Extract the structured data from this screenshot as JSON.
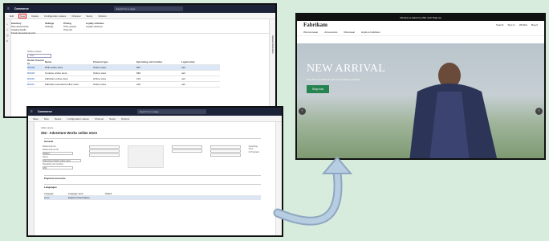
{
  "shot1": {
    "app_name": "Commerce",
    "search_placeholder": "Search for a page",
    "toolbar": [
      "Edit",
      "New",
      "Delete",
      "Configuration values",
      "Channel",
      "Setup",
      "Options"
    ],
    "highlighted_tool": "New",
    "ribbon": [
      {
        "header": "Inventory",
        "items": [
          "New assortments",
          "Catalog details",
          "Fiscal transactional print"
        ]
      },
      {
        "header": "Settings",
        "items": [
          "Settings"
        ]
      },
      {
        "header": "Pricing",
        "items": [
          "Price groups",
          "Price list"
        ]
      },
      {
        "header": "Loyalty schemes",
        "items": [
          "Loyalty schemes"
        ]
      }
    ],
    "list_title": "Online stores",
    "filter_placeholder": "Filter",
    "columns": [
      "Retail Channel Id",
      "Name",
      "Channel type",
      "Operating unit number",
      "Legal entity"
    ],
    "rows": [
      [
        "RS002",
        "RTE online store",
        "Online store",
        "097",
        "usrt"
      ],
      [
        "RS003",
        "Contoso online store",
        "Online store",
        "099",
        "usrt"
      ],
      [
        "RS016",
        "Fabrikam online store",
        "Online store",
        "123",
        "usrt"
      ],
      [
        "RS017",
        "Fabrikam extended online store",
        "Online store",
        "126",
        "usrt"
      ]
    ],
    "side_panel_label": "Related information"
  },
  "shot2": {
    "app_name": "Commerce",
    "search_placeholder": "Search for a page",
    "toolbar": [
      "Save",
      "New",
      "Delete",
      "Configuration values",
      "Channel",
      "Setup",
      "Options"
    ],
    "breadcrumb": "Online stores",
    "form_title": "252 : Adventure Works online store",
    "general_tab": "General",
    "fields": [
      {
        "label": "Retail channel",
        "value": ""
      },
      {
        "label": "Retail channel ID",
        "value": "RS021"
      },
      {
        "label": "Name",
        "value": "Adventure Works online store"
      },
      {
        "label": "Operating unit number",
        "value": "252"
      }
    ],
    "payment_tab": "Payment accounts",
    "languages_tab": "Languages",
    "lang_columns": [
      "Language",
      "Language name",
      "Default"
    ],
    "lang_rows": [
      [
        "en-us",
        "English (United States)",
        ""
      ]
    ],
    "status_label": "Operating store",
    "status_value": "In Progress"
  },
  "shot3": {
    "promo_bar": "Receive a welcome offer now! Sign up",
    "brand": "Fabrikam",
    "utility": [
      "Search",
      "Sign In",
      "Wishlist",
      "Bag 0"
    ],
    "nav": [
      "Womenswear",
      "Accessories",
      "Menswear",
      "Explore Fabrikam"
    ],
    "hero_title": "NEW ARRIVAL",
    "hero_subtitle": "View the new collection with all new designer fashions",
    "hero_button": "Shop now"
  },
  "colors": {
    "background": "#d7ecdc",
    "arrow": "#9fb8d0",
    "highlight": "#e02020",
    "shop_button": "#27834f"
  }
}
